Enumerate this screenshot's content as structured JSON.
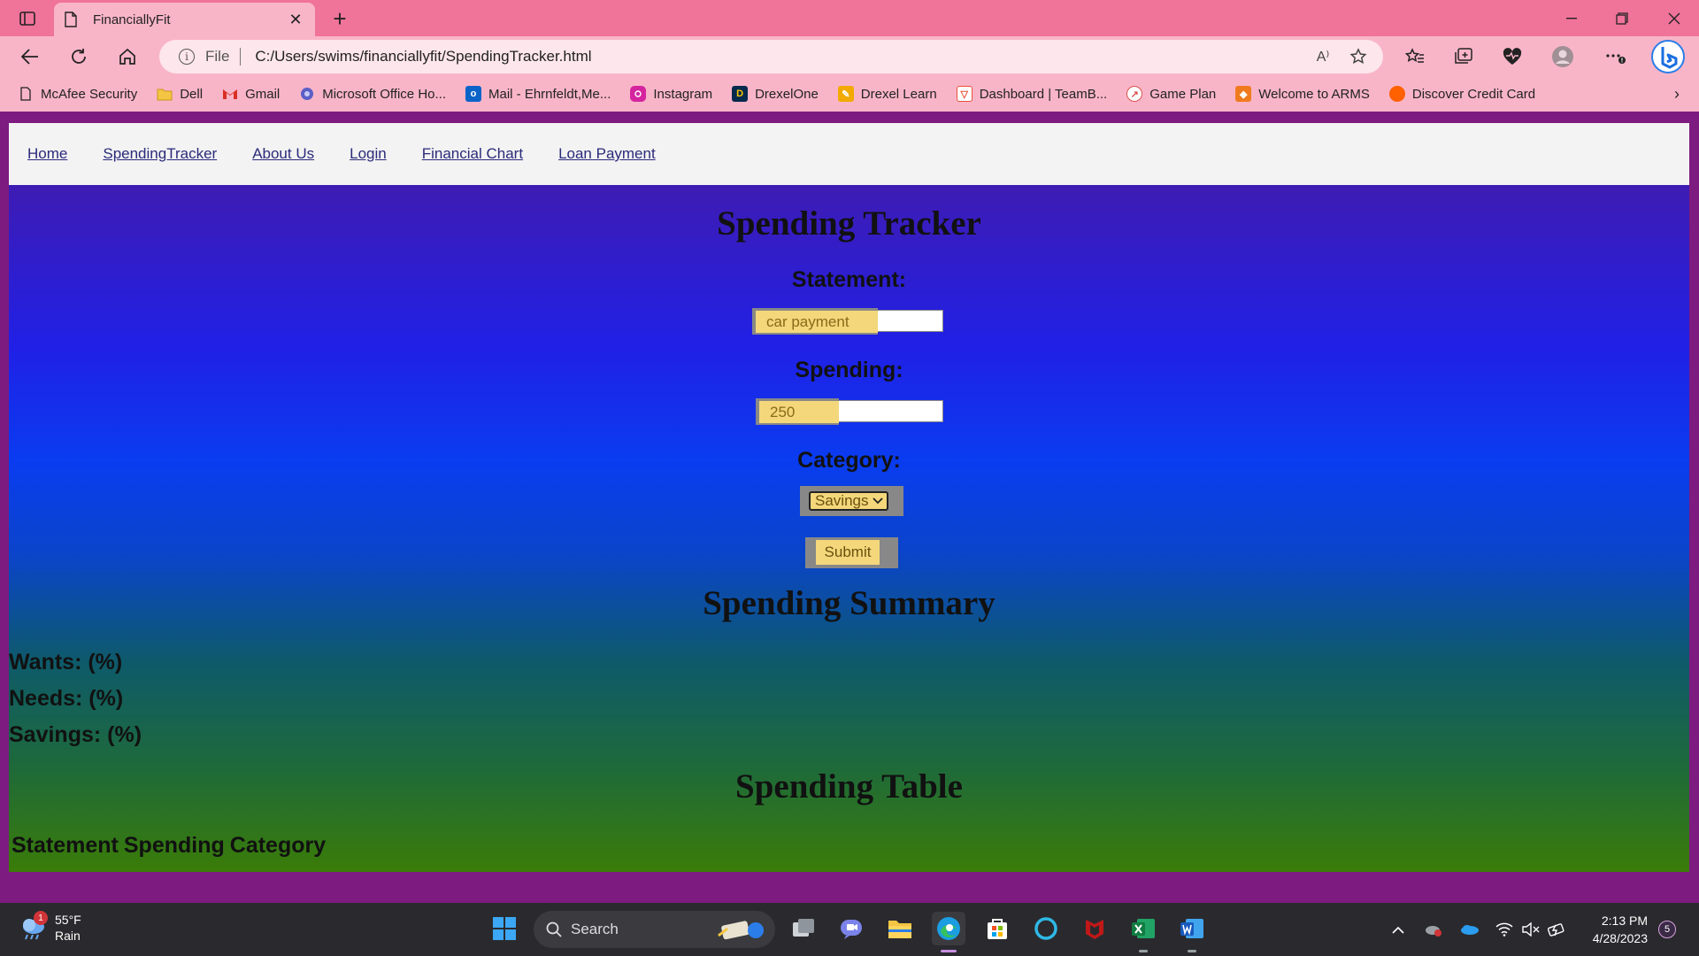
{
  "browser": {
    "tab_title": "FinanciallyFit",
    "address_scheme": "File",
    "address_url": "C:/Users/swims/financiallyfit/SpendingTracker.html",
    "read_aloud_glyph": "A⁾"
  },
  "bookmarks": [
    {
      "label": "McAfee Security",
      "icon": "document-icon",
      "color": "#ffffff"
    },
    {
      "label": "Dell",
      "icon": "folder-icon",
      "color": "#f4c542"
    },
    {
      "label": "Gmail",
      "icon": "gmail-icon",
      "color": "#d93025"
    },
    {
      "label": "Microsoft Office Ho...",
      "icon": "office-icon",
      "color": "#5b5fc7"
    },
    {
      "label": "Mail - Ehrnfeldt,Me...",
      "icon": "outlook-icon",
      "color": "#0a64c8"
    },
    {
      "label": "Instagram",
      "icon": "instagram-icon",
      "color": "#d6249f"
    },
    {
      "label": "DrexelOne",
      "icon": "drexel-dragon-icon",
      "color": "#07294d"
    },
    {
      "label": "Drexel Learn",
      "icon": "learn-icon",
      "color": "#f2a900"
    },
    {
      "label": "Dashboard | TeamB...",
      "icon": "teamb-icon",
      "color": "#e8503a"
    },
    {
      "label": "Game Plan",
      "icon": "gameplan-icon",
      "color": "#d9534f"
    },
    {
      "label": "Welcome to ARMS",
      "icon": "arms-icon",
      "color": "#f07b1e"
    },
    {
      "label": "Discover Credit Card",
      "icon": "discover-icon",
      "color": "#ff6000"
    }
  ],
  "nav": {
    "items": [
      "Home",
      "SpendingTracker",
      "About Us",
      "Login",
      "Financial Chart",
      "Loan Payment"
    ]
  },
  "page": {
    "title": "Spending Tracker",
    "statement_label": "Statement:",
    "statement_value": "car payment",
    "spending_label": "Spending:",
    "spending_value": "250",
    "category_label": "Category:",
    "category_selected": "Savings",
    "submit_label": "Submit",
    "summary_title": "Spending Summary",
    "summary_rows": [
      "Wants: (%)",
      "Needs: (%)",
      "Savings: (%)"
    ],
    "table_title": "Spending Table",
    "table_headers": [
      "Statement",
      "Spending",
      "Category"
    ]
  },
  "taskbar": {
    "weather_temp": "55°F",
    "weather_desc": "Rain",
    "weather_badge": "1",
    "search_label": "Search",
    "time": "2:13 PM",
    "date": "4/28/2023",
    "notification_count": "5"
  },
  "colors": {
    "chrome_tabbar": "#f07399",
    "chrome_toolbar": "#f9b5c8",
    "input_highlight": "#f3d77a",
    "page_gradient_top": "#4a1aa0",
    "page_gradient_mid": "#0a3cf0",
    "page_gradient_bottom": "#3a7c08"
  }
}
